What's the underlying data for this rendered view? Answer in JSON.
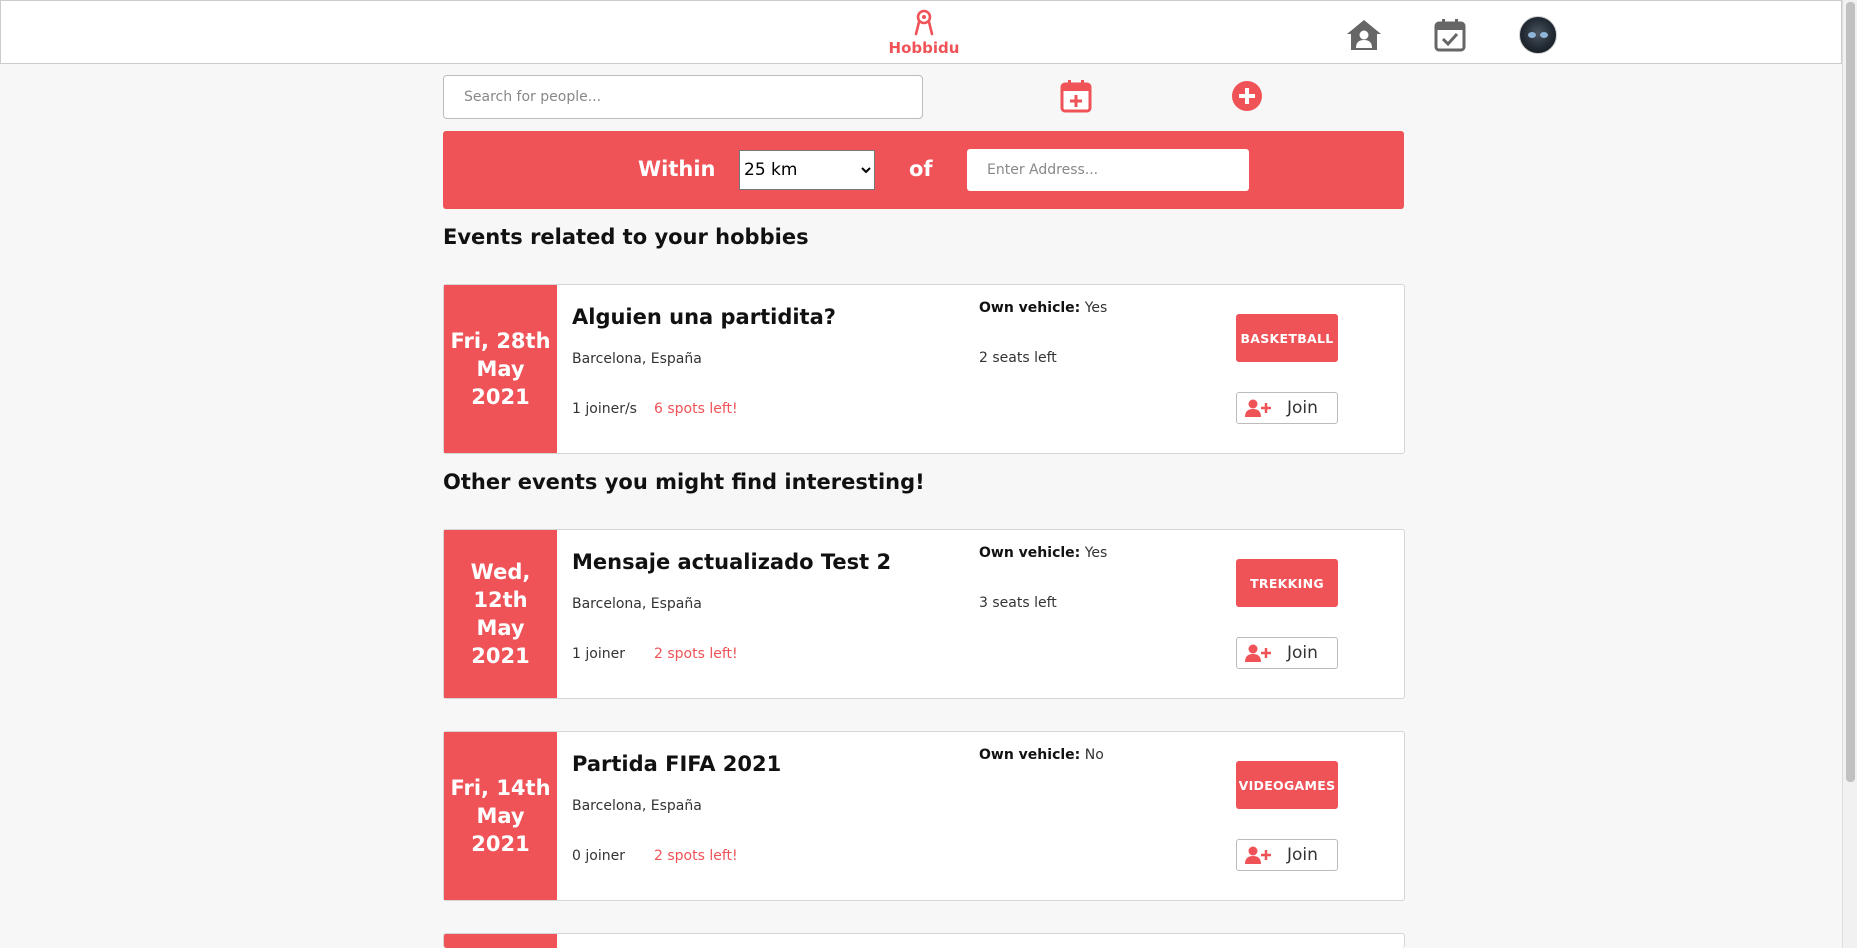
{
  "header": {
    "brand": "Hobbidu",
    "brand_color": "#ef5257",
    "nav": [
      {
        "name": "home",
        "icon": "home-user-icon"
      },
      {
        "name": "my-events",
        "icon": "calendar-check-icon"
      },
      {
        "name": "profile",
        "icon": "avatar"
      }
    ]
  },
  "search": {
    "placeholder": "Search for people..."
  },
  "toolbar": {
    "create_event_icon": "calendar-plus-icon",
    "add_icon": "plus-circle-icon"
  },
  "filter": {
    "within_label": "Within",
    "distance_value": "25 km",
    "distance_options": [
      "25 km"
    ],
    "of_label": "of",
    "address_placeholder": "Enter Address..."
  },
  "sections": {
    "related_title": "Events related to your hobbies",
    "other_title": "Other events you might find interesting!"
  },
  "events": [
    {
      "date_line1": "Fri, 28th",
      "date_line2": "May 2021",
      "title": "Alguien una partidita?",
      "location": "Barcelona, España",
      "joiners": "1 joiner/s",
      "spots": "6 spots left!",
      "vehicle_label": "Own vehicle:",
      "vehicle_value": "Yes",
      "seats": "2 seats left",
      "tag": "BASKETBALL",
      "join_label": "Join"
    },
    {
      "date_line1": "Wed, 12th",
      "date_line2": "May 2021",
      "title": "Mensaje actualizado Test 2",
      "location": "Barcelona, España",
      "joiners": "1 joiner",
      "spots": "2 spots left!",
      "vehicle_label": "Own vehicle:",
      "vehicle_value": "Yes",
      "seats": "3 seats left",
      "tag": "TREKKING",
      "join_label": "Join"
    },
    {
      "date_line1": "Fri, 14th",
      "date_line2": "May 2021",
      "title": "Partida FIFA 2021",
      "location": "Barcelona, España",
      "joiners": "0 joiner",
      "spots": "2 spots left!",
      "vehicle_label": "Own vehicle:",
      "vehicle_value": "No",
      "seats": "",
      "tag": "VIDEOGAMES",
      "join_label": "Join"
    }
  ]
}
